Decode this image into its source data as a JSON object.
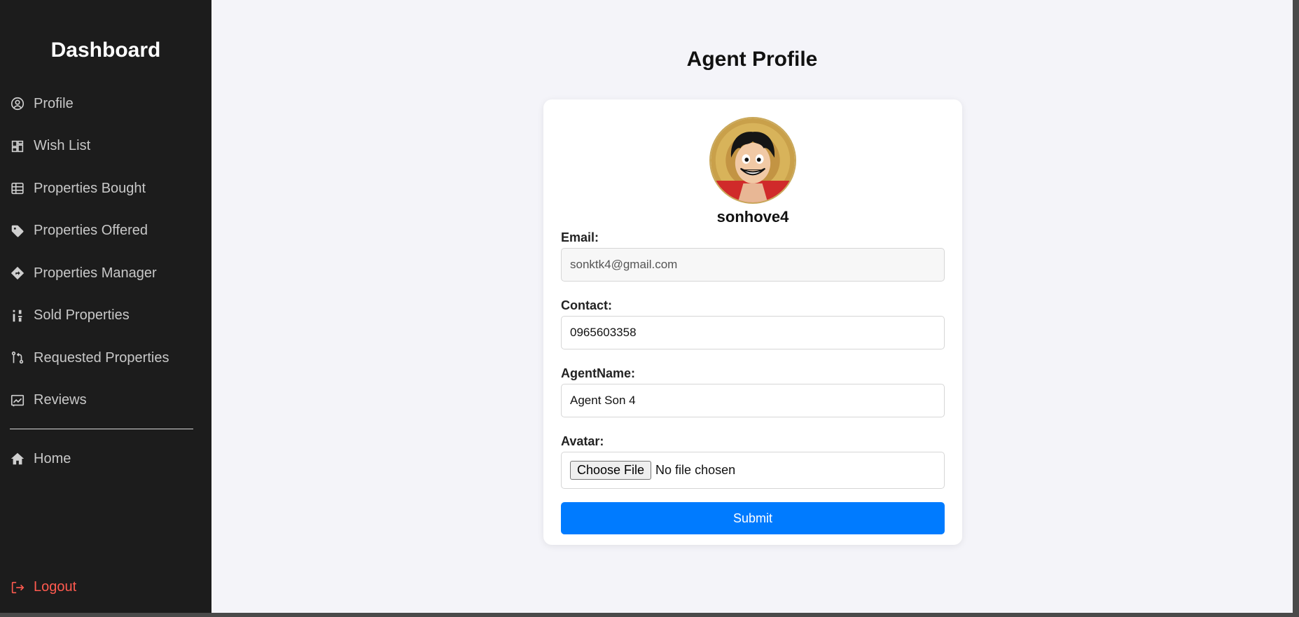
{
  "sidebar": {
    "title": "Dashboard",
    "items": [
      {
        "label": "Profile",
        "icon": "user-circle-icon"
      },
      {
        "label": "Wish List",
        "icon": "dashboard-grid-icon"
      },
      {
        "label": "Properties Bought",
        "icon": "table-icon"
      },
      {
        "label": "Properties Offered",
        "icon": "tag-icon"
      },
      {
        "label": "Properties Manager",
        "icon": "diamond-direction-icon"
      },
      {
        "label": "Sold Properties",
        "icon": "sort-numeric-icon"
      },
      {
        "label": "Requested Properties",
        "icon": "git-pull-request-icon"
      },
      {
        "label": "Reviews",
        "icon": "chart-board-icon"
      }
    ],
    "home": {
      "label": "Home",
      "icon": "home-icon"
    },
    "logout": {
      "label": "Logout",
      "icon": "logout-icon"
    }
  },
  "main": {
    "title": "Agent Profile",
    "profile": {
      "username": "sonhove4",
      "email_label": "Email:",
      "email_value": "sonktk4@gmail.com",
      "contact_label": "Contact:",
      "contact_value": "0965603358",
      "agent_name_label": "AgentName:",
      "agent_name_value": "Agent Son 4",
      "avatar_label": "Avatar:",
      "file_button_label": "Choose File",
      "file_status": "No file chosen",
      "submit_label": "Submit"
    }
  },
  "colors": {
    "sidebar_bg": "#1c1c1c",
    "main_bg": "#f4f4f9",
    "accent": "#007bff",
    "logout": "#ff5a4f"
  }
}
